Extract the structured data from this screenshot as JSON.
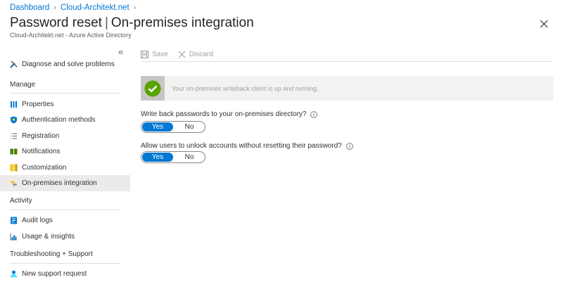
{
  "breadcrumb": {
    "items": [
      "Dashboard",
      "Cloud-Architekt.net"
    ]
  },
  "header": {
    "title": "Password reset",
    "section": "On-premises integration",
    "subtitle": "Cloud-Architekt.net - Azure Active Directory"
  },
  "sidebar": {
    "top_item": "Diagnose and solve problems",
    "manage_heading": "Manage",
    "manage_items": [
      "Properties",
      "Authentication methods",
      "Registration",
      "Notifications",
      "Customization",
      "On-premises integration"
    ],
    "activity_heading": "Activity",
    "activity_items": [
      "Audit logs",
      "Usage & insights"
    ],
    "support_heading": "Troubleshooting + Support",
    "support_items": [
      "New support request"
    ],
    "selected": "On-premises integration"
  },
  "toolbar": {
    "save_label": "Save",
    "discard_label": "Discard"
  },
  "banner": {
    "message": "Your on-premises writeback client is up and running."
  },
  "settings": {
    "writeback_question": "Write back passwords to your on-premises directory?",
    "unlock_question": "Allow users to unlock accounts without resetting their password?",
    "yes_label": "Yes",
    "no_label": "No",
    "writeback_value": "Yes",
    "unlock_value": "Yes"
  },
  "colors": {
    "accent": "#0078d4",
    "success": "#57a300",
    "selected_bg": "#edebe9"
  }
}
